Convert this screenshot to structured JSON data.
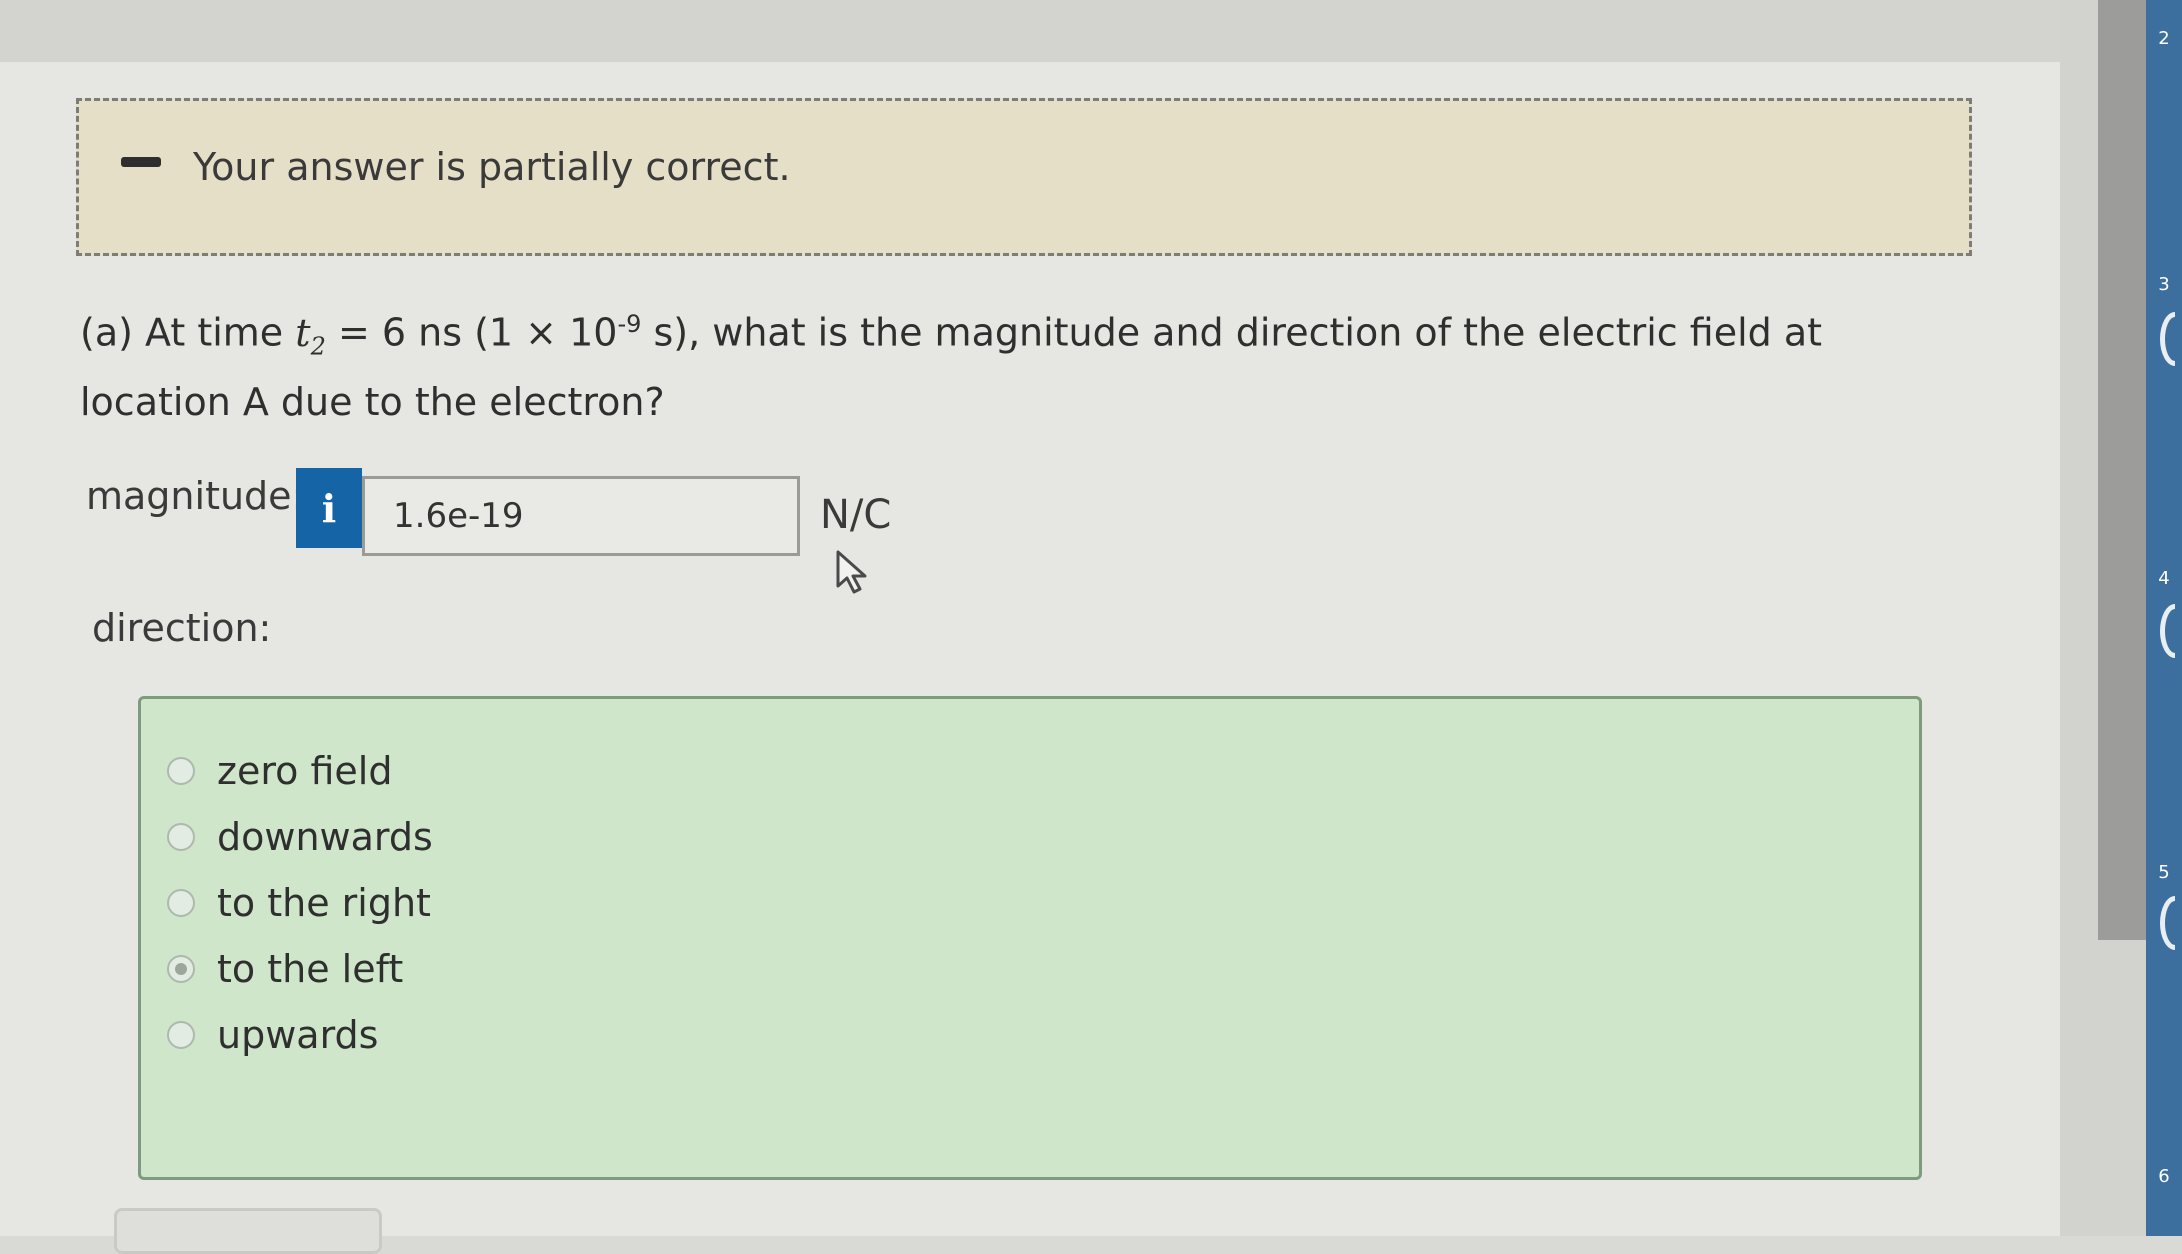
{
  "feedback": {
    "message": "Your answer is partially correct."
  },
  "question": {
    "part": "(a) At time",
    "variable": "t",
    "subscript": "2",
    "equals": "=",
    "time_value": "6 ns (1 × 10",
    "exponent": "-9",
    "rest": " s), what is the magnitude and direction of the electric field at location A due to the electron?"
  },
  "magnitude": {
    "label": "magnitude:",
    "info_icon": "info-icon",
    "info_glyph": "i",
    "value": "1.6e-19",
    "unit": "N/C"
  },
  "direction": {
    "label": "direction:",
    "options": [
      {
        "label": "zero field",
        "checked": false
      },
      {
        "label": "downwards",
        "checked": false
      },
      {
        "label": "to the right",
        "checked": false
      },
      {
        "label": "to the left",
        "checked": true
      },
      {
        "label": "upwards",
        "checked": false
      }
    ]
  },
  "sidebar": {
    "numbers": [
      "2",
      "3",
      "4",
      "5",
      "6"
    ]
  },
  "colors": {
    "feedback_bg": "#e6dfc7",
    "choices_bg": "#cfe6cb",
    "info_button": "#1565a6",
    "sidebar_blue": "#3d6f9e"
  }
}
